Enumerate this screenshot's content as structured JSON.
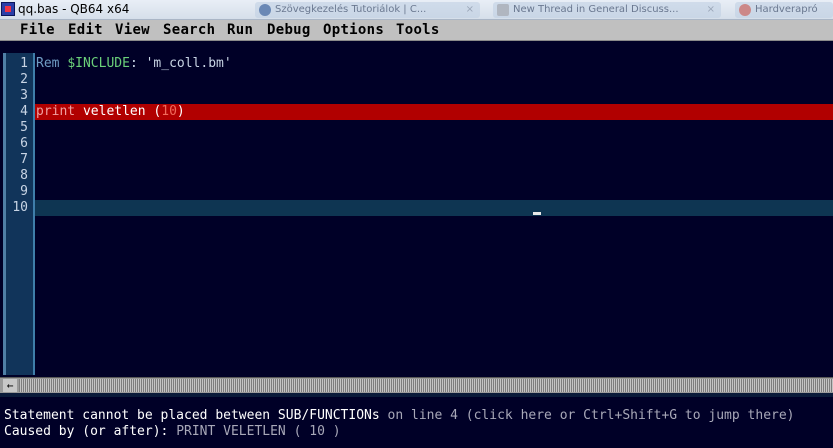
{
  "window": {
    "title": "qq.bas - QB64 x64",
    "background_tabs": [
      {
        "label": "Szövegkezelés Tutoriálok | C..."
      },
      {
        "label": "New Thread in General Discuss..."
      },
      {
        "label": "Hardverapró"
      }
    ]
  },
  "menu": {
    "items": [
      "File",
      "Edit",
      "View",
      "Search",
      "Run",
      "Debug",
      "Options",
      "Tools"
    ]
  },
  "editor": {
    "line_numbers": [
      "1",
      "2",
      "3",
      "4",
      "5",
      "6",
      "7",
      "8",
      "9",
      "10"
    ],
    "line1": {
      "keyword": "Rem",
      "metacommand": "$INCLUDE",
      "sep": ": ",
      "string": "'m_coll.bm'"
    },
    "line4": {
      "keyword": "print",
      "ident": "veletlen",
      "open": "(",
      "number": "10",
      "close": ")"
    },
    "error_line": 4,
    "cursor_line": 10
  },
  "status": {
    "message": "Statement cannot be placed between SUB/FUNCTIONs",
    "location": " on line 4 (click here or Ctrl+Shift+G to jump there)",
    "cause_label": "Caused by (or after): ",
    "cause_text": "PRINT VELETLEN ( 10 )"
  },
  "colors": {
    "editor_bg": "#000027",
    "error_highlight": "#b10000",
    "cursor_line_highlight": "#0e3552",
    "gutter": "#11345a",
    "menu_bg": "#c0c0c0"
  },
  "icons": [
    "qb64-app-icon",
    "scroll-left-arrow-icon",
    "text-cursor-icon"
  ]
}
